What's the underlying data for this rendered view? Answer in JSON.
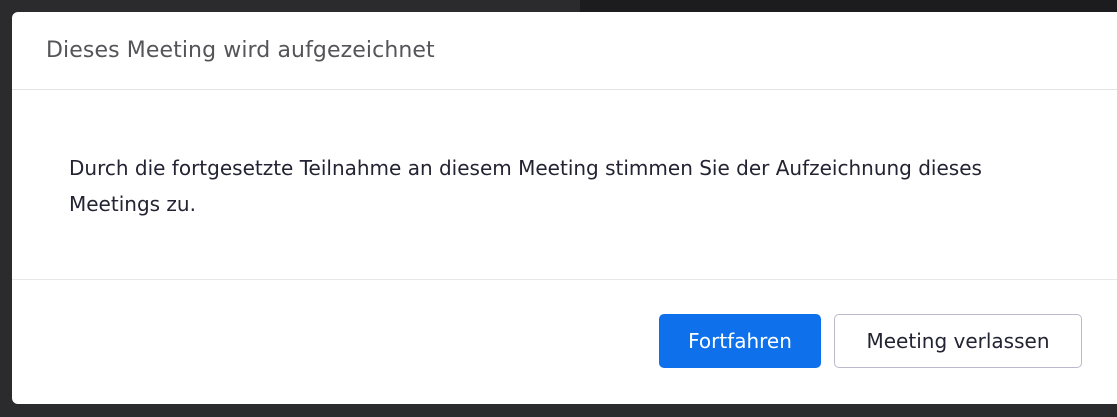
{
  "dialog": {
    "title": "Dieses Meeting wird aufgezeichnet",
    "message": "Durch die fortgesetzte Teilnahme an diesem Meeting stimmen Sie der Aufzeichnung dieses Meetings zu.",
    "buttons": {
      "continue_label": "Fortfahren",
      "leave_label": "Meeting verlassen"
    }
  },
  "colors": {
    "primary": "#0e71eb",
    "background": "#2b2b2d",
    "dialog_bg": "#ffffff",
    "title_text": "#555559",
    "body_text": "#232333",
    "secondary_border": "#babacc"
  }
}
